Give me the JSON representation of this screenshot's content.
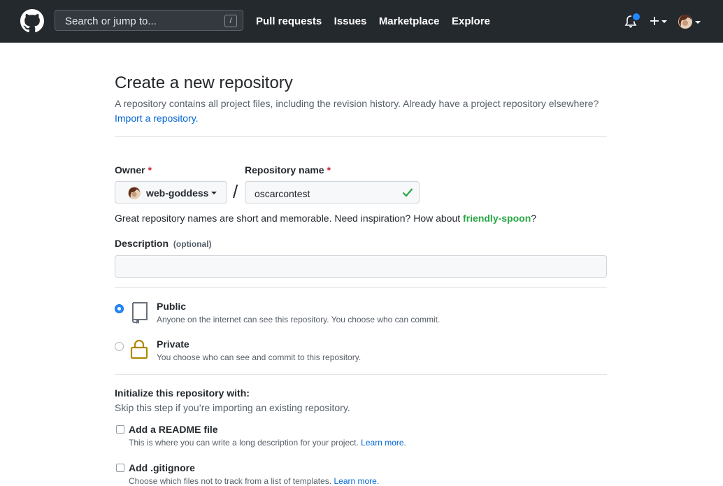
{
  "header": {
    "search_placeholder": "Search or jump to...",
    "search_shortcut": "/",
    "nav": [
      "Pull requests",
      "Issues",
      "Marketplace",
      "Explore"
    ]
  },
  "page": {
    "title": "Create a new repository",
    "subtitle": "A repository contains all project files, including the revision history. Already have a project repository elsewhere?",
    "import_link": "Import a repository."
  },
  "form": {
    "owner_label": "Owner",
    "required_mark": "*",
    "owner_value": "web-goddess",
    "repo_label": "Repository name",
    "separator": "/",
    "repo_value": "oscarcontest",
    "hint_text": "Great repository names are short and memorable. Need inspiration? How about",
    "hint_suggestion": "friendly-spoon",
    "hint_end": "?",
    "description_label": "Description",
    "description_optional": "(optional)",
    "description_value": ""
  },
  "visibility": {
    "selected": "Public",
    "public_title": "Public",
    "public_desc": "Anyone on the internet can see this repository. You choose who can commit.",
    "private_title": "Private",
    "private_desc": "You choose who can see and commit to this repository."
  },
  "init": {
    "title": "Initialize this repository with:",
    "subtitle": "Skip this step if you’re importing an existing repository.",
    "readme_title": "Add a README file",
    "readme_desc": "This is where you can write a long description for your project.",
    "gitignore_title": "Add .gitignore",
    "gitignore_desc": "Choose which files not to track from a list of templates.",
    "learn_more": "Learn more."
  },
  "colors": {
    "header_bg": "#24292e",
    "link": "#0366d6",
    "success": "#28a745",
    "required": "#cb2431",
    "notification": "#2188ff",
    "lock": "#b08800"
  },
  "icons": {
    "logo": "github-mark-icon",
    "bell": "bell-icon",
    "plus": "plus-icon",
    "check": "check-icon",
    "public": "repo-icon",
    "private": "lock-icon"
  }
}
